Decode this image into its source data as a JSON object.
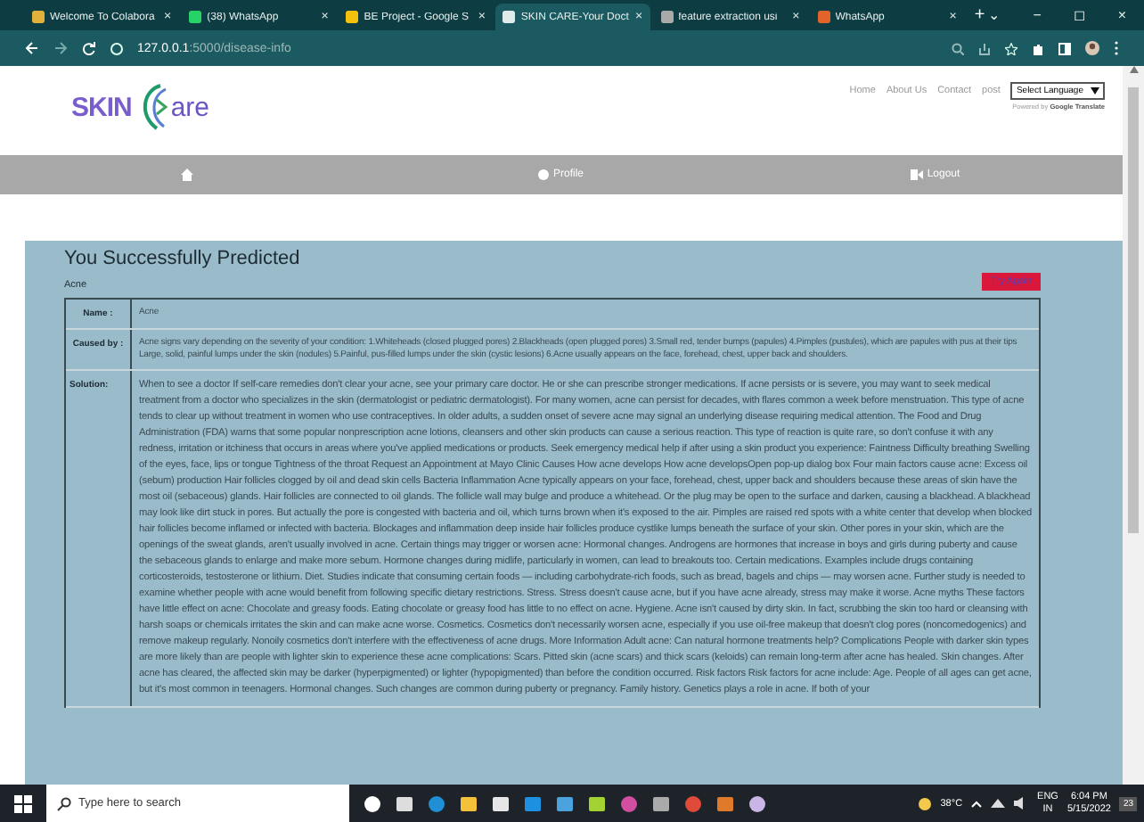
{
  "browser": {
    "tabs": [
      {
        "title": "Welcome To Colabora",
        "selected": false,
        "close": "×"
      },
      {
        "title": "(38) WhatsApp",
        "selected": false,
        "close": "×"
      },
      {
        "title": "BE Project - Google S",
        "selected": false,
        "close": "×"
      },
      {
        "title": "SKIN CARE-Your Doct",
        "selected": true,
        "close": "×"
      },
      {
        "title": "feature extraction usi",
        "selected": false,
        "close": "×"
      },
      {
        "title": "WhatsApp",
        "selected": false,
        "close": "×"
      }
    ],
    "new_tab": "+",
    "window_controls": [
      "⌄",
      "−",
      "◻",
      "×"
    ],
    "address_host": "127.0.0.1",
    "address_path": ":5000/disease-info"
  },
  "header": {
    "logo_left": "SKIN",
    "logo_right": "are",
    "nav": [
      "Home",
      "About Us",
      "Contact",
      "post"
    ],
    "language_select": "Select Language",
    "powered_by": "Powered by",
    "translate": "Google Translate"
  },
  "menu": [
    {
      "kind": "home"
    },
    {
      "label": "Profile",
      "kind": "profile"
    },
    {
      "label": "Logout",
      "kind": "logout"
    }
  ],
  "result": {
    "title": "You Successfully Predicted",
    "disease": "Acne",
    "try_again": "Try Again",
    "rows": [
      {
        "label": "Name :",
        "text": "Acne"
      },
      {
        "label": "Caused by :",
        "text": "Acne signs vary depending on the severity of your condition: 1.Whiteheads (closed plugged pores) 2.Blackheads (open plugged pores) 3.Small red, tender bumps (papules) 4.Pimples (pustules), which are papules with pus at their tips Large, solid, painful lumps under the skin (nodules) 5.Painful, pus-filled lumps under the skin (cystic lesions) 6.Acne usually appears on the face, forehead, chest, upper back and shoulders."
      },
      {
        "label": "Solution:",
        "text": "When to see a doctor If self-care remedies don't clear your acne, see your primary care doctor. He or she can prescribe stronger medications. If acne persists or is severe, you may want to seek medical treatment from a doctor who specializes in the skin (dermatologist or pediatric dermatologist). For many women, acne can persist for decades, with flares common a week before menstruation. This type of acne tends to clear up without treatment in women who use contraceptives. In older adults, a sudden onset of severe acne may signal an underlying disease requiring medical attention. The Food and Drug Administration (FDA) warns that some popular nonprescription acne lotions, cleansers and other skin products can cause a serious reaction. This type of reaction is quite rare, so don't confuse it with any redness, irritation or itchiness that occurs in areas where you've applied medications or products. Seek emergency medical help if after using a skin product you experience: Faintness Difficulty breathing Swelling of the eyes, face, lips or tongue Tightness of the throat Request an Appointment at Mayo Clinic Causes How acne develops How acne developsOpen pop-up dialog box Four main factors cause acne: Excess oil (sebum) production Hair follicles clogged by oil and dead skin cells Bacteria Inflammation Acne typically appears on your face, forehead, chest, upper back and shoulders because these areas of skin have the most oil (sebaceous) glands. Hair follicles are connected to oil glands. The follicle wall may bulge and produce a whitehead. Or the plug may be open to the surface and darken, causing a blackhead. A blackhead may look like dirt stuck in pores. But actually the pore is congested with bacteria and oil, which turns brown when it's exposed to the air. Pimples are raised red spots with a white center that develop when blocked hair follicles become inflamed or infected with bacteria. Blockages and inflammation deep inside hair follicles produce cystlike lumps beneath the surface of your skin. Other pores in your skin, which are the openings of the sweat glands, aren't usually involved in acne. Certain things may trigger or worsen acne: Hormonal changes. Androgens are hormones that increase in boys and girls during puberty and cause the sebaceous glands to enlarge and make more sebum. Hormone changes during midlife, particularly in women, can lead to breakouts too. Certain medications. Examples include drugs containing corticosteroids, testosterone or lithium. Diet. Studies indicate that consuming certain foods — including carbohydrate-rich foods, such as bread, bagels and chips — may worsen acne. Further study is needed to examine whether people with acne would benefit from following specific dietary restrictions. Stress. Stress doesn't cause acne, but if you have acne already, stress may make it worse. Acne myths These factors have little effect on acne: Chocolate and greasy foods. Eating chocolate or greasy food has little to no effect on acne. Hygiene. Acne isn't caused by dirty skin. In fact, scrubbing the skin too hard or cleansing with harsh soaps or chemicals irritates the skin and can make acne worse. Cosmetics. Cosmetics don't necessarily worsen acne, especially if you use oil-free makeup that doesn't clog pores (noncomedogenics) and remove makeup regularly. Nonoily cosmetics don't interfere with the effectiveness of acne drugs. More Information Adult acne: Can natural hormone treatments help? Complications People with darker skin types are more likely than are people with lighter skin to experience these acne complications: Scars. Pitted skin (acne scars) and thick scars (keloids) can remain long-term after acne has healed. Skin changes. After acne has cleared, the affected skin may be darker (hyperpigmented) or lighter (hypopigmented) than before the condition occurred. Risk factors Risk factors for acne include: Age. People of all ages can get acne, but it's most common in teenagers. Hormonal changes. Such changes are common during puberty or pregnancy. Family history. Genetics plays a role in acne. If both of your"
      }
    ]
  },
  "taskbar": {
    "search_placeholder": "Type here to search",
    "temperature": "38°C",
    "language": "ENG",
    "region": "IN",
    "time": "6:04 PM",
    "date": "5/15/2022",
    "notifications": "23"
  }
}
